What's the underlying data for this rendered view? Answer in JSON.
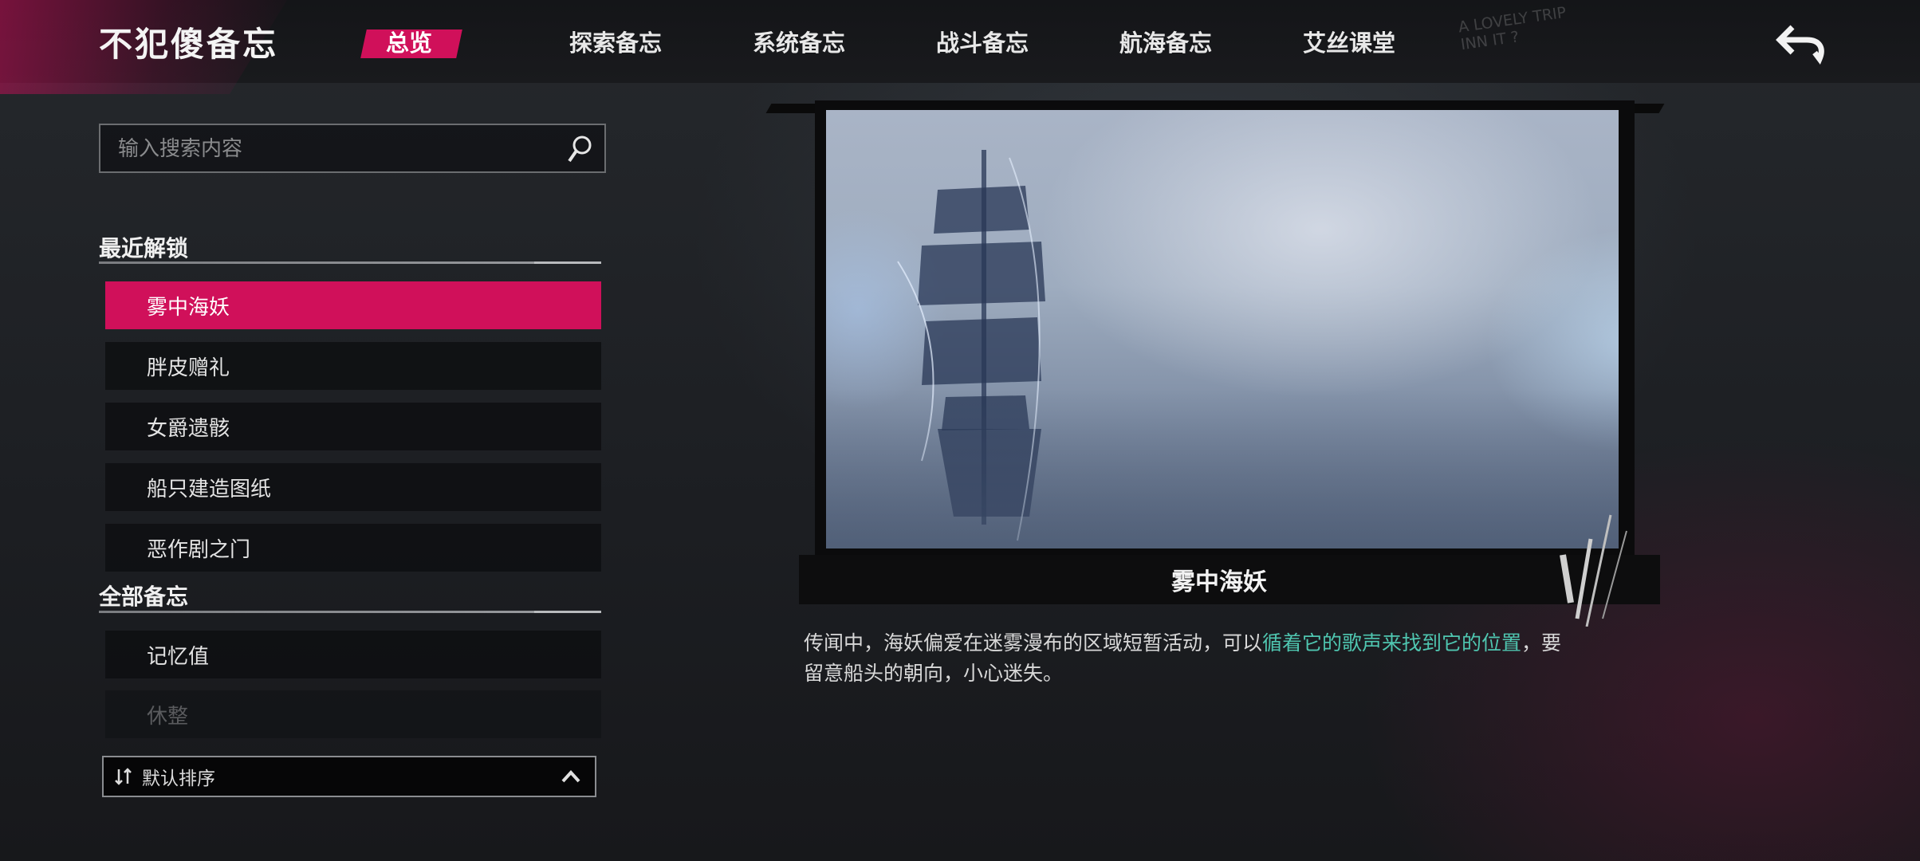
{
  "app": {
    "title": "不犯傻备忘"
  },
  "tabs": [
    {
      "label": "总览",
      "active": true
    },
    {
      "label": "探索备忘",
      "active": false
    },
    {
      "label": "系统备忘",
      "active": false
    },
    {
      "label": "战斗备忘",
      "active": false
    },
    {
      "label": "航海备忘",
      "active": false
    },
    {
      "label": "艾丝课堂",
      "active": false
    }
  ],
  "header_scribble": {
    "line1": "A LOVELY TRIP",
    "line2": "INN IT ?"
  },
  "back_icon": "back-arrow-icon",
  "search": {
    "placeholder": "输入搜索内容",
    "value": "",
    "icon": "search-icon"
  },
  "recent": {
    "title": "最近解锁",
    "items": [
      {
        "label": "雾中海妖",
        "selected": true
      },
      {
        "label": "胖皮赠礼",
        "selected": false
      },
      {
        "label": "女爵遗骸",
        "selected": false
      },
      {
        "label": "船只建造图纸",
        "selected": false
      },
      {
        "label": "恶作剧之门",
        "selected": false
      }
    ]
  },
  "all": {
    "title": "全部备忘",
    "items": [
      {
        "label": "记忆值"
      },
      {
        "label": "休整"
      }
    ]
  },
  "sort": {
    "label": "默认排序",
    "icon": "sort-icon",
    "toggle_icon": "chevron-up-icon"
  },
  "detail": {
    "caption": "雾中海妖",
    "description_plain_1": "传闻中，海妖偏爱在迷雾漫布的区域短暂活动，可以",
    "description_highlight": "循着它的歌声来找到它的位置",
    "description_plain_2": "，要留意船头的朝向，小心迷失。"
  },
  "colors": {
    "accent": "#d0105a",
    "highlight_text": "#4fc6b0",
    "background": "#1c1e22"
  }
}
